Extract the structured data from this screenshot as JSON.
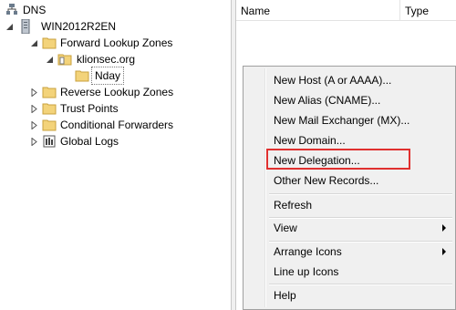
{
  "tree": {
    "root": "DNS",
    "server": "WIN2012R2EN",
    "forward_zones": "Forward Lookup Zones",
    "zone": "klionsec.org",
    "subfolder": "Nday",
    "reverse_zones": "Reverse Lookup Zones",
    "trust_points": "Trust Points",
    "conditional_forwarders": "Conditional Forwarders",
    "global_logs": "Global Logs"
  },
  "list": {
    "columns": {
      "name": "Name",
      "type": "Type"
    }
  },
  "menu": {
    "new_host": "New Host (A or AAAA)...",
    "new_alias": "New Alias (CNAME)...",
    "new_mx": "New Mail Exchanger (MX)...",
    "new_domain": "New Domain...",
    "new_delegation": "New Delegation...",
    "other_records": "Other New Records...",
    "refresh": "Refresh",
    "view": "View",
    "arrange_icons": "Arrange Icons",
    "line_up_icons": "Line up Icons",
    "help": "Help"
  },
  "colors": {
    "highlight_border": "#e0302f",
    "folder": "#f3d37a"
  },
  "icons": {
    "dns": "dns-icon",
    "server": "server-icon",
    "folder": "folder-icon",
    "zone": "zone-folder-icon",
    "log": "log-icon"
  }
}
